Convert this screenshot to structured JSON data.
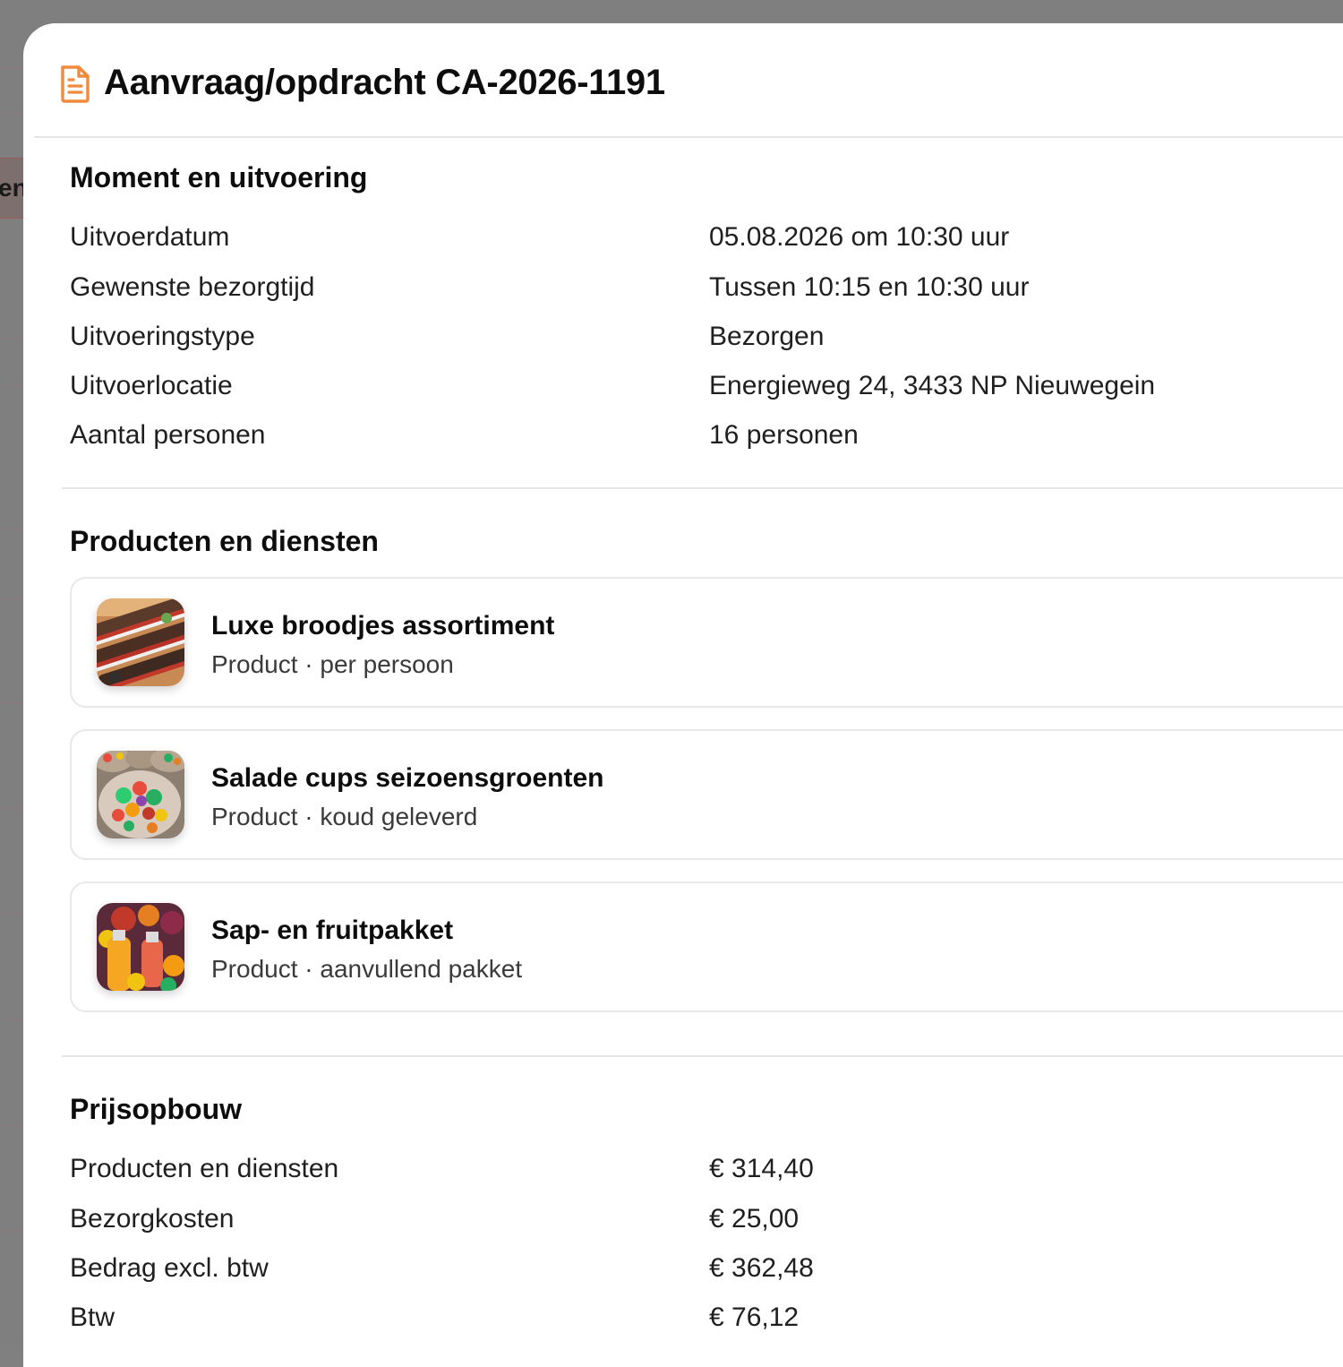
{
  "background": {
    "partial_tab_text": "en"
  },
  "modal": {
    "title": "Aanvraag/opdracht CA-2026-1191",
    "title_icon": "document-icon",
    "accent_color": "#f08a3c"
  },
  "moment": {
    "heading": "Moment en uitvoering",
    "rows": [
      {
        "label": "Uitvoerdatum",
        "value": "05.08.2026 om 10:30 uur"
      },
      {
        "label": "Gewenste bezorgtijd",
        "value": "Tussen 10:15 en 10:30 uur"
      },
      {
        "label": "Uitvoeringstype",
        "value": "Bezorgen"
      },
      {
        "label": "Uitvoerlocatie",
        "value": "Energieweg 24, 3433 NP Nieuwegein"
      },
      {
        "label": "Aantal personen",
        "value": "16 personen"
      }
    ]
  },
  "products": {
    "heading": "Producten en diensten",
    "items": [
      {
        "name": "Luxe broodjes assortiment",
        "meta": "Product · per persoon",
        "image": "sandwich-platter-photo"
      },
      {
        "name": "Salade cups seizoensgroenten",
        "meta": "Product · koud geleverd",
        "image": "salad-cups-photo"
      },
      {
        "name": "Sap- en fruitpakket",
        "meta": "Product · aanvullend pakket",
        "image": "juice-fruit-photo"
      }
    ]
  },
  "pricing": {
    "heading": "Prijsopbouw",
    "rows": [
      {
        "label": "Producten en diensten",
        "value": "€ 314,40"
      },
      {
        "label": "Bezorgkosten",
        "value": "€ 25,00"
      },
      {
        "label": "Bedrag excl. btw",
        "value": "€ 362,48"
      },
      {
        "label": "Btw",
        "value": "€ 76,12"
      }
    ]
  }
}
